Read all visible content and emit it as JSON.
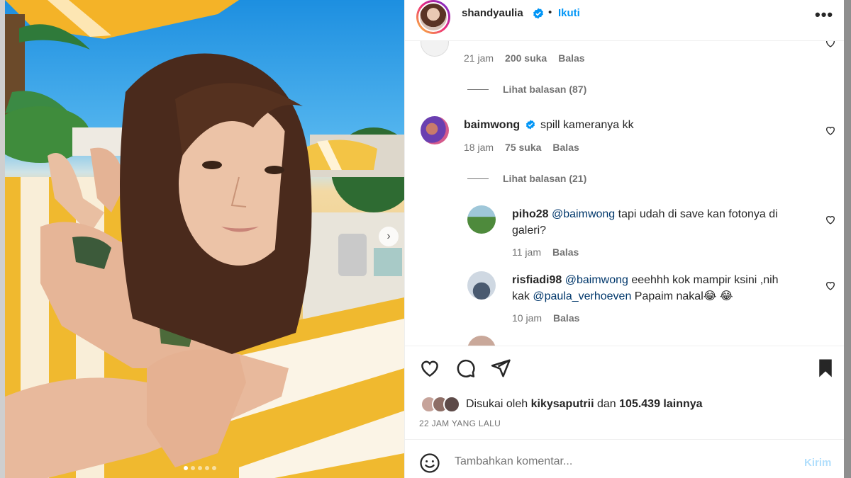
{
  "header": {
    "username": "shandyaulia",
    "separator": "•",
    "follow_label": "Ikuti",
    "more_label": "•••"
  },
  "comments": [
    {
      "time": "21 jam",
      "likes": "200 suka",
      "reply_label": "Balas",
      "view_replies": "Lihat balasan (87)"
    },
    {
      "username": "baimwong",
      "text": "spill kameranya kk",
      "time": "18 jam",
      "likes": "75 suka",
      "reply_label": "Balas",
      "view_replies": "Lihat balasan (21)",
      "replies": [
        {
          "username": "piho28",
          "mention": "@baimwong",
          "text_line1": " tapi udah di save kan fotonya di",
          "text_line2": "galeri?",
          "time": "11 jam",
          "reply_label": "Balas"
        },
        {
          "username": "risfiadi98",
          "mention": "@baimwong",
          "text_line1": " eeehhh kok mampir ksini ,nih",
          "text_line2_prefix": "kak ",
          "mention2": "@paula_verhoeven",
          "text_line2_suffix": " Papaim nakal😂 😂",
          "time": "10 jam",
          "reply_label": "Balas"
        }
      ]
    }
  ],
  "actions": {
    "liked_by_prefix": "Disukai oleh ",
    "liked_by_user": "kikysaputrii",
    "liked_by_mid": " dan ",
    "liked_by_count": "105.439 lainnya",
    "time_ago": "22 JAM YANG LALU"
  },
  "add_comment": {
    "placeholder": "Tambahkan komentar...",
    "post_label": "Kirim"
  },
  "icons": [
    "verified-icon",
    "heart-icon",
    "comment-icon",
    "share-icon",
    "save-icon",
    "emoji-icon"
  ],
  "colors": {
    "accent": "#0095f6",
    "mention": "#00376b",
    "muted": "#737373",
    "post_disabled": "#b2dffc"
  },
  "carousel": {
    "slides": 5,
    "active": 1
  }
}
